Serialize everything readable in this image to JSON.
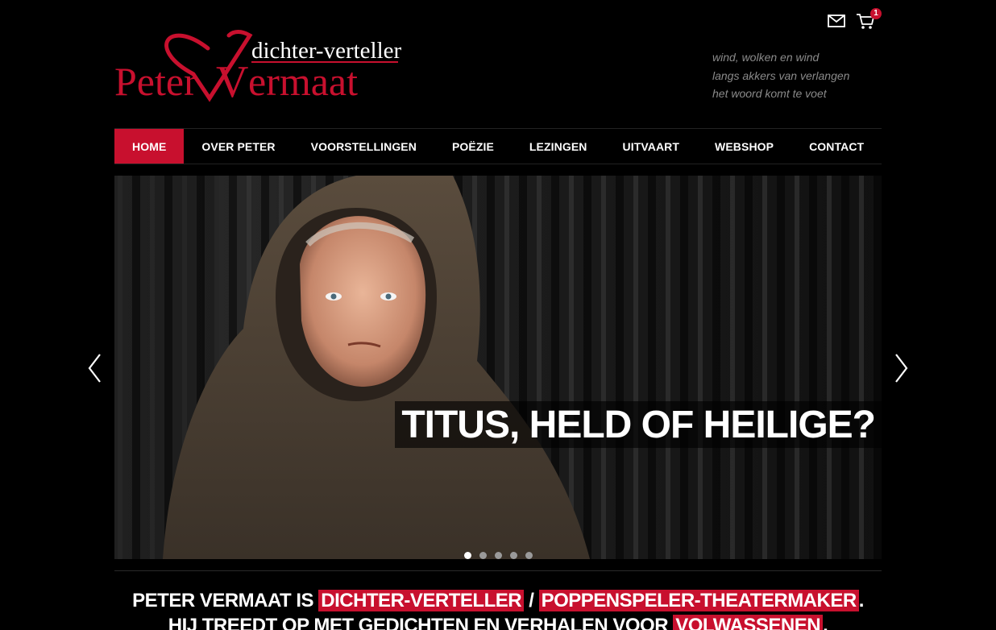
{
  "header": {
    "mail_icon": "mail-icon",
    "cart_icon": "cart-icon",
    "cart_count": "1"
  },
  "logo": {
    "subtitle": "dichter-verteller",
    "first_name": "Peter",
    "last_name_initial": "V",
    "last_name_rest": "ermaat"
  },
  "tagline": {
    "lines": [
      "wind, wolken en wind",
      "langs akkers van verlangen",
      "het woord komt te voet"
    ]
  },
  "nav": {
    "items": [
      {
        "label": "HOME",
        "active": true
      },
      {
        "label": "OVER PETER"
      },
      {
        "label": "VOORSTELLINGEN"
      },
      {
        "label": "POËZIE"
      },
      {
        "label": "LEZINGEN"
      },
      {
        "label": "UITVAART"
      },
      {
        "label": "WEBSHOP"
      },
      {
        "label": "CONTACT"
      }
    ]
  },
  "slider": {
    "caption": "TITUS, HELD OF HEILIGE?",
    "slide_count": 5,
    "active_index": 0
  },
  "intro": {
    "line1_prefix": "PETER VERMAAT IS",
    "role1": "DICHTER-VERTELLER",
    "separator": "/",
    "role2": "POPPENSPELER-THEATERMAKER",
    "line1_end": ".",
    "line2_prefix": "HIJ TREEDT OP MET GEDICHTEN EN VERHALEN VOOR",
    "audience": "VOLWASSENEN",
    "line2_end": "."
  },
  "colors": {
    "accent": "#c8102e",
    "background": "#000000",
    "tagline": "#8a8a8a"
  }
}
